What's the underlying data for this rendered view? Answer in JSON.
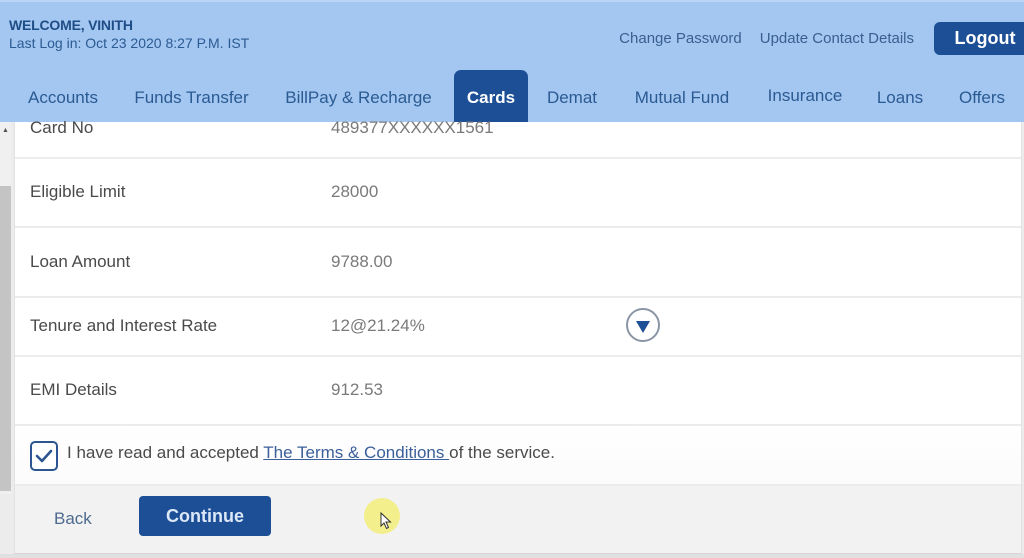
{
  "header": {
    "welcome": "WELCOME, VINITH",
    "last_login": "Last Log in: Oct 23 2020 8:27 P.M. IST",
    "links": {
      "change_password": "Change Password",
      "update_contact": "Update Contact Details"
    },
    "logout_label": "Logout"
  },
  "nav": {
    "items": [
      {
        "label": "Accounts",
        "active": false
      },
      {
        "label": "Funds Transfer",
        "active": false
      },
      {
        "label": "BillPay & Recharge",
        "active": false
      },
      {
        "label": "Cards",
        "active": true
      },
      {
        "label": "Demat",
        "active": false
      },
      {
        "label": "Mutual Fund",
        "active": false
      },
      {
        "label": "Insurance",
        "active": false
      },
      {
        "label": "Loans",
        "active": false
      },
      {
        "label": "Offers",
        "active": false
      }
    ]
  },
  "details": {
    "rows": [
      {
        "label": "Card No",
        "value": "489377XXXXXX1561"
      },
      {
        "label": "Eligible Limit",
        "value": "28000"
      },
      {
        "label": "Loan Amount",
        "value": "9788.00"
      },
      {
        "label": "Tenure and Interest Rate",
        "value": "12@21.24%"
      },
      {
        "label": "EMI Details",
        "value": "912.53"
      }
    ],
    "tenure_dropdown_icon": "triangle-down-icon"
  },
  "terms": {
    "checked": true,
    "prefix": "I have read and accepted ",
    "link_text": "The Terms & Conditions ",
    "suffix": "of the service."
  },
  "footer": {
    "back_label": "Back",
    "continue_label": "Continue"
  },
  "colors": {
    "header_bg": "#a3c7f1",
    "primary": "#1c4f95",
    "nav_text": "#2b5a92"
  }
}
